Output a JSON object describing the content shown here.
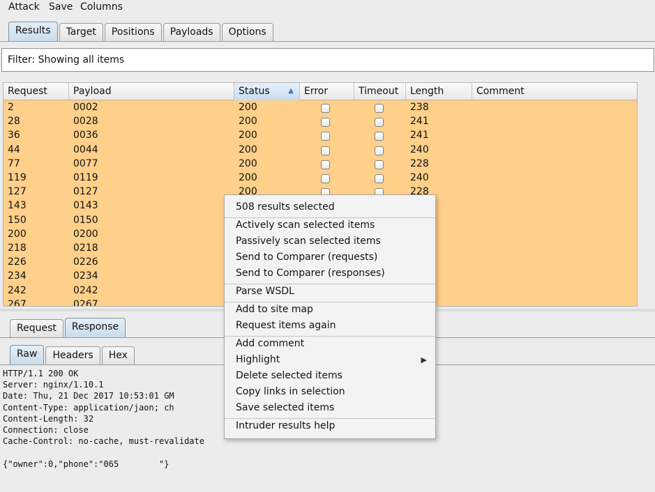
{
  "menubar": [
    "Attack",
    "Save",
    "Columns"
  ],
  "top_tabs": [
    {
      "label": "Results",
      "active": true
    },
    {
      "label": "Target",
      "active": false
    },
    {
      "label": "Positions",
      "active": false
    },
    {
      "label": "Payloads",
      "active": false
    },
    {
      "label": "Options",
      "active": false
    }
  ],
  "filter": {
    "text": "Filter: Showing all items"
  },
  "table": {
    "columns": [
      "Request",
      "Payload",
      "Status",
      "Error",
      "Timeout",
      "Length",
      "Comment"
    ],
    "sorted_column": "Status",
    "sort_direction": "ascending",
    "rows": [
      {
        "request": "2",
        "payload": "0002",
        "status": "200",
        "length": "238"
      },
      {
        "request": "28",
        "payload": "0028",
        "status": "200",
        "length": "241"
      },
      {
        "request": "36",
        "payload": "0036",
        "status": "200",
        "length": "241"
      },
      {
        "request": "44",
        "payload": "0044",
        "status": "200",
        "length": "240"
      },
      {
        "request": "77",
        "payload": "0077",
        "status": "200",
        "length": "228"
      },
      {
        "request": "119",
        "payload": "0119",
        "status": "200",
        "length": "240"
      },
      {
        "request": "127",
        "payload": "0127",
        "status": "200",
        "length": "228"
      },
      {
        "request": "143",
        "payload": "0143",
        "status": "",
        "length": ""
      },
      {
        "request": "150",
        "payload": "0150",
        "status": "",
        "length": ""
      },
      {
        "request": "200",
        "payload": "0200",
        "status": "",
        "length": ""
      },
      {
        "request": "218",
        "payload": "0218",
        "status": "",
        "length": ""
      },
      {
        "request": "226",
        "payload": "0226",
        "status": "",
        "length": ""
      },
      {
        "request": "234",
        "payload": "0234",
        "status": "",
        "length": ""
      },
      {
        "request": "242",
        "payload": "0242",
        "status": "",
        "length": ""
      },
      {
        "request": "267",
        "payload": "0267",
        "status": "",
        "length": ""
      }
    ],
    "selected_row_color": "#ffd08a"
  },
  "message_tabs": [
    {
      "label": "Request",
      "active": false
    },
    {
      "label": "Response",
      "active": true
    }
  ],
  "view_tabs": [
    {
      "label": "Raw",
      "active": true
    },
    {
      "label": "Headers",
      "active": false
    },
    {
      "label": "Hex",
      "active": false
    }
  ],
  "response_raw": [
    "HTTP/1.1 200 OK",
    "Server: nginx/1.10.1",
    "Date: Thu, 21 Dec 2017 10:53:01 GM",
    "Content-Type: application/jaon; ch",
    "Content-Length: 32",
    "Connection: close",
    "Cache-Control: no-cache, must-revalidate",
    "",
    "{\"owner\":0,\"phone\":\"065        \"}"
  ],
  "context_menu": {
    "header": "508 results selected",
    "groups": [
      [
        "Actively scan selected items",
        "Passively scan selected items",
        "Send to Comparer (requests)",
        "Send to Comparer (responses)"
      ],
      [
        "Parse WSDL"
      ],
      [
        "Add to site map",
        "Request items again"
      ],
      [
        "Add comment",
        "Highlight",
        "Delete selected items",
        "Copy links in selection",
        "Save selected items"
      ],
      [
        "Intruder results help"
      ]
    ],
    "submenu_items": [
      "Highlight"
    ]
  }
}
